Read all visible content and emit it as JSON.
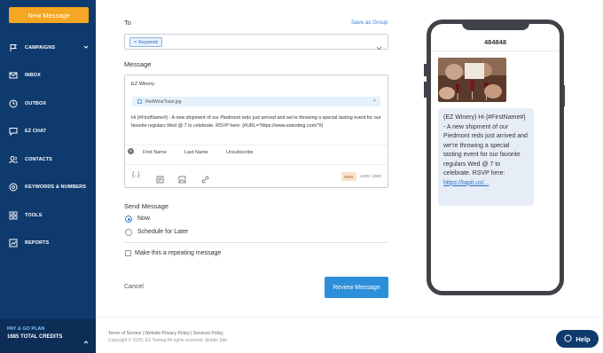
{
  "sidebar": {
    "new_message": "New Message",
    "items": [
      {
        "label": "CAMPAIGNS",
        "icon": "flag-icon",
        "has_chevron": true
      },
      {
        "label": "INBOX",
        "icon": "inbox-icon"
      },
      {
        "label": "OUTBOX",
        "icon": "clock-icon"
      },
      {
        "label": "EZ CHAT",
        "icon": "chat-icon"
      },
      {
        "label": "CONTACTS",
        "icon": "contacts-icon"
      },
      {
        "label": "KEYWORDS & NUMBERS",
        "icon": "keywords-icon"
      },
      {
        "label": "TOOLS",
        "icon": "tools-icon"
      },
      {
        "label": "REPORTS",
        "icon": "reports-icon"
      }
    ],
    "plan_title": "PAY & GO PLAN",
    "plan_credits": "1685 TOTAL CREDITS"
  },
  "form": {
    "to_label": "To",
    "save_as_group": "Save as Group",
    "to_chip": "Keyword",
    "message_label": "Message",
    "company": "EZ Winery",
    "attachment": "RedWineToast.jpg",
    "body": "Hi {#FirstName#} - A new shipment of our Piedmont reds just arrived and we're throwing a special tasting event for our favorite regulars Wed @ 7 to celebrate. RSVP here: {#URL=\"https://www.eztexting.com/\"#}",
    "tags": [
      "First Name",
      "Last Name",
      "Unsubscribe"
    ],
    "mms_badge": "MMS",
    "char_count": "1400 / 1600",
    "send_label": "Send Message",
    "send_now": "Now",
    "send_later": "Schedule for Later",
    "repeat_label": "Make this a repeating message",
    "cancel": "Cancel",
    "review": "Review Message"
  },
  "phone": {
    "number": "484848",
    "bubble_text": "(EZ Winery) Hi {#FirstName#} - A new shipment of our Piedmont reds just arrived and we're throwing a special tasting event for our favorite regulars Wed @ 7 to celebrate. RSVP here: ",
    "bubble_link": "https://tapit.us/..."
  },
  "footer": {
    "links": "Terms of Service  |  Website Privacy Policy  |  Services Policy",
    "copyright": "Copyright © 2020, EZ Texting All rights reserved. Mobile Site"
  },
  "help": "Help",
  "colors": {
    "sidebar": "#0f3a6e",
    "new_message": "#f5a623",
    "primary": "#2d8fd9",
    "bubble": "#e6edf7"
  }
}
